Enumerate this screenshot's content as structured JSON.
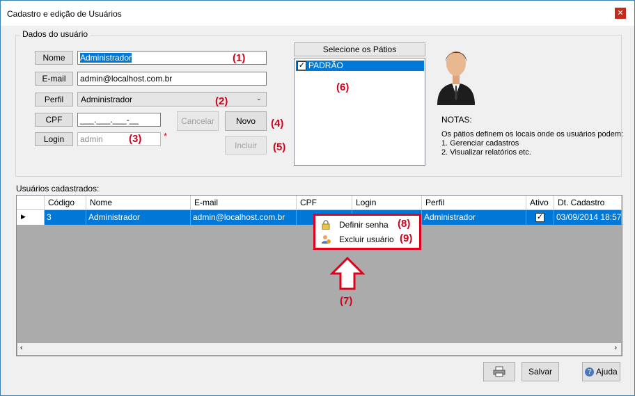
{
  "window": {
    "title": "Cadastro e edição de Usuários"
  },
  "group": {
    "legend": "Dados do usuário"
  },
  "form": {
    "nome_label": "Nome",
    "nome_value": "Administrador",
    "email_label": "E-mail",
    "email_value": "admin@localhost.com.br",
    "perfil_label": "Perfil",
    "perfil_value": "Administrador",
    "cpf_label": "CPF",
    "cpf_value": "___.___.___-__",
    "login_label": "Login",
    "login_value": "admin",
    "required_mark": "*"
  },
  "buttons": {
    "cancelar": "Cancelar",
    "novo": "Novo",
    "incluir": "Incluir",
    "salvar": "Salvar",
    "ajuda": "Ajuda"
  },
  "patios": {
    "header": "Selecione os Pátios",
    "items": [
      {
        "label": "PADRÃO",
        "checked": true
      }
    ]
  },
  "notes": {
    "title": "NOTAS:",
    "line1": "Os pátios definem os locais onde os usuários podem:",
    "line2": "1. Gerenciar cadastros",
    "line3": "2. Visualizar relatórios etc."
  },
  "grid": {
    "label": "Usuários cadastrados:",
    "columns": [
      "Código",
      "Nome",
      "E-mail",
      "CPF",
      "Login",
      "Perfil",
      "Ativo",
      "Dt. Cadastro"
    ],
    "rows": [
      {
        "codigo": "3",
        "nome": "Administrador",
        "email": "admin@localhost.com.br",
        "cpf": "",
        "login": "",
        "perfil": "Administrador",
        "ativo": true,
        "dt_cadastro": "03/09/2014 18:57"
      }
    ]
  },
  "context_menu": {
    "items": [
      {
        "label": "Definir senha",
        "icon": "lock-icon"
      },
      {
        "label": "Excluir usuário",
        "icon": "user-remove-icon"
      }
    ]
  },
  "annotations": {
    "a1": "(1)",
    "a2": "(2)",
    "a3": "(3)",
    "a4": "(4)",
    "a5": "(5)",
    "a6": "(6)",
    "a7": "(7)",
    "a8": "(8)",
    "a9": "(9)"
  },
  "colors": {
    "selection": "#0078d7",
    "annotation": "#d0021b"
  }
}
